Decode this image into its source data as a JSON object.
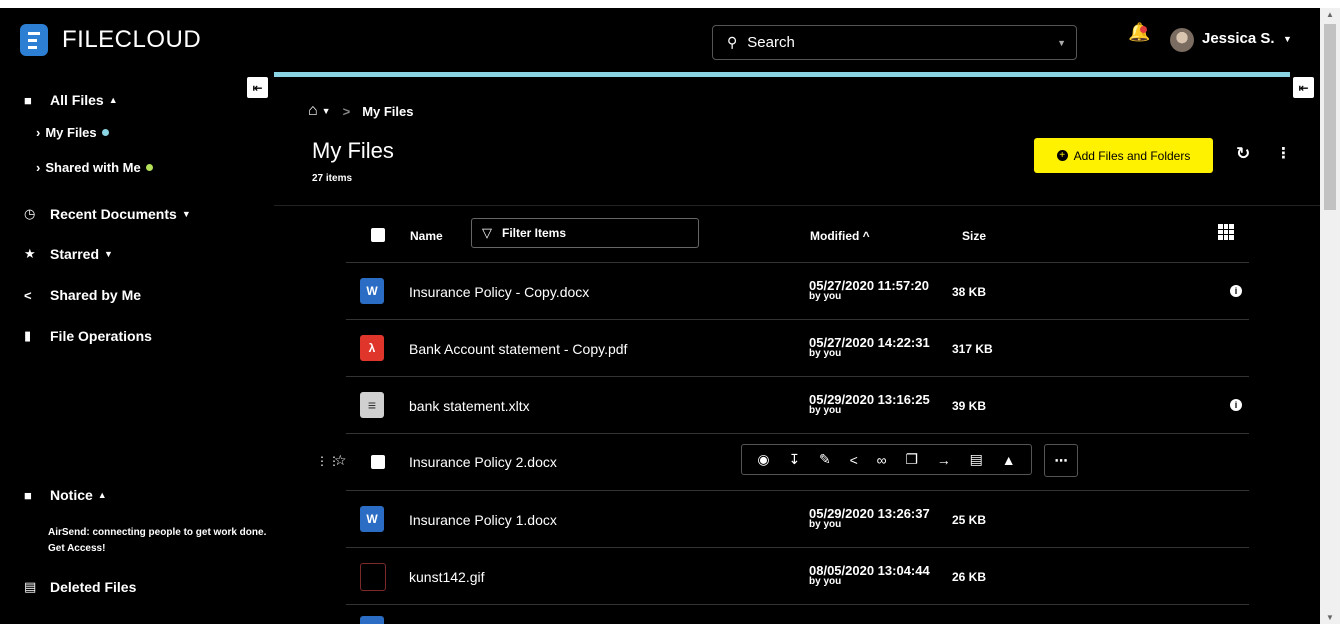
{
  "app": {
    "logo_text": "FILECLOUD"
  },
  "search": {
    "placeholder": "Search"
  },
  "user": {
    "name": "Jessica S."
  },
  "sidebar": {
    "all_files": "All Files",
    "my_files": "My Files",
    "shared_with_me": "Shared with Me",
    "recent_documents": "Recent Documents",
    "starred": "Starred",
    "shared_by_me": "Shared by Me",
    "file_operations": "File Operations",
    "notice": "Notice",
    "notice_text": "AirSend: connecting people to get work done. Get Access!",
    "deleted_files": "Deleted Files"
  },
  "colors": {
    "accent_yellow": "#fff200",
    "accent_cyan": "#8ad4e3",
    "dot_blue": "#8ad4e3",
    "dot_green": "#b4e05a"
  },
  "main": {
    "breadcrumb_current": "My Files",
    "title": "My Files",
    "item_count": "27 items",
    "add_button": "Add Files and Folders"
  },
  "table": {
    "col_name": "Name",
    "filter_placeholder": "Filter Items",
    "col_modified": "Modified ^",
    "col_size": "Size",
    "rows": [
      {
        "name": "Insurance Policy - Copy.docx",
        "modified": "05/27/2020 11:57:20",
        "by": "by you",
        "size": "38 KB",
        "icon": "word-icon"
      },
      {
        "name": "Bank Account statement - Copy.pdf",
        "modified": "05/27/2020 14:22:31",
        "by": "by you",
        "size": "317 KB",
        "icon": "pdf-icon"
      },
      {
        "name": "bank statement.xltx",
        "modified": "05/29/2020 13:16:25",
        "by": "by you",
        "size": "39 KB",
        "icon": "document-icon"
      },
      {
        "name": "Insurance Policy 2.docx",
        "modified": "",
        "by": "",
        "size": "",
        "icon": "checkbox"
      },
      {
        "name": "Insurance Policy 1.docx",
        "modified": "05/29/2020 13:26:37",
        "by": "by you",
        "size": "25 KB",
        "icon": "word-icon"
      },
      {
        "name": "kunst142.gif",
        "modified": "08/05/2020 13:04:44",
        "by": "by you",
        "size": "26 KB",
        "icon": "image-icon"
      }
    ]
  }
}
